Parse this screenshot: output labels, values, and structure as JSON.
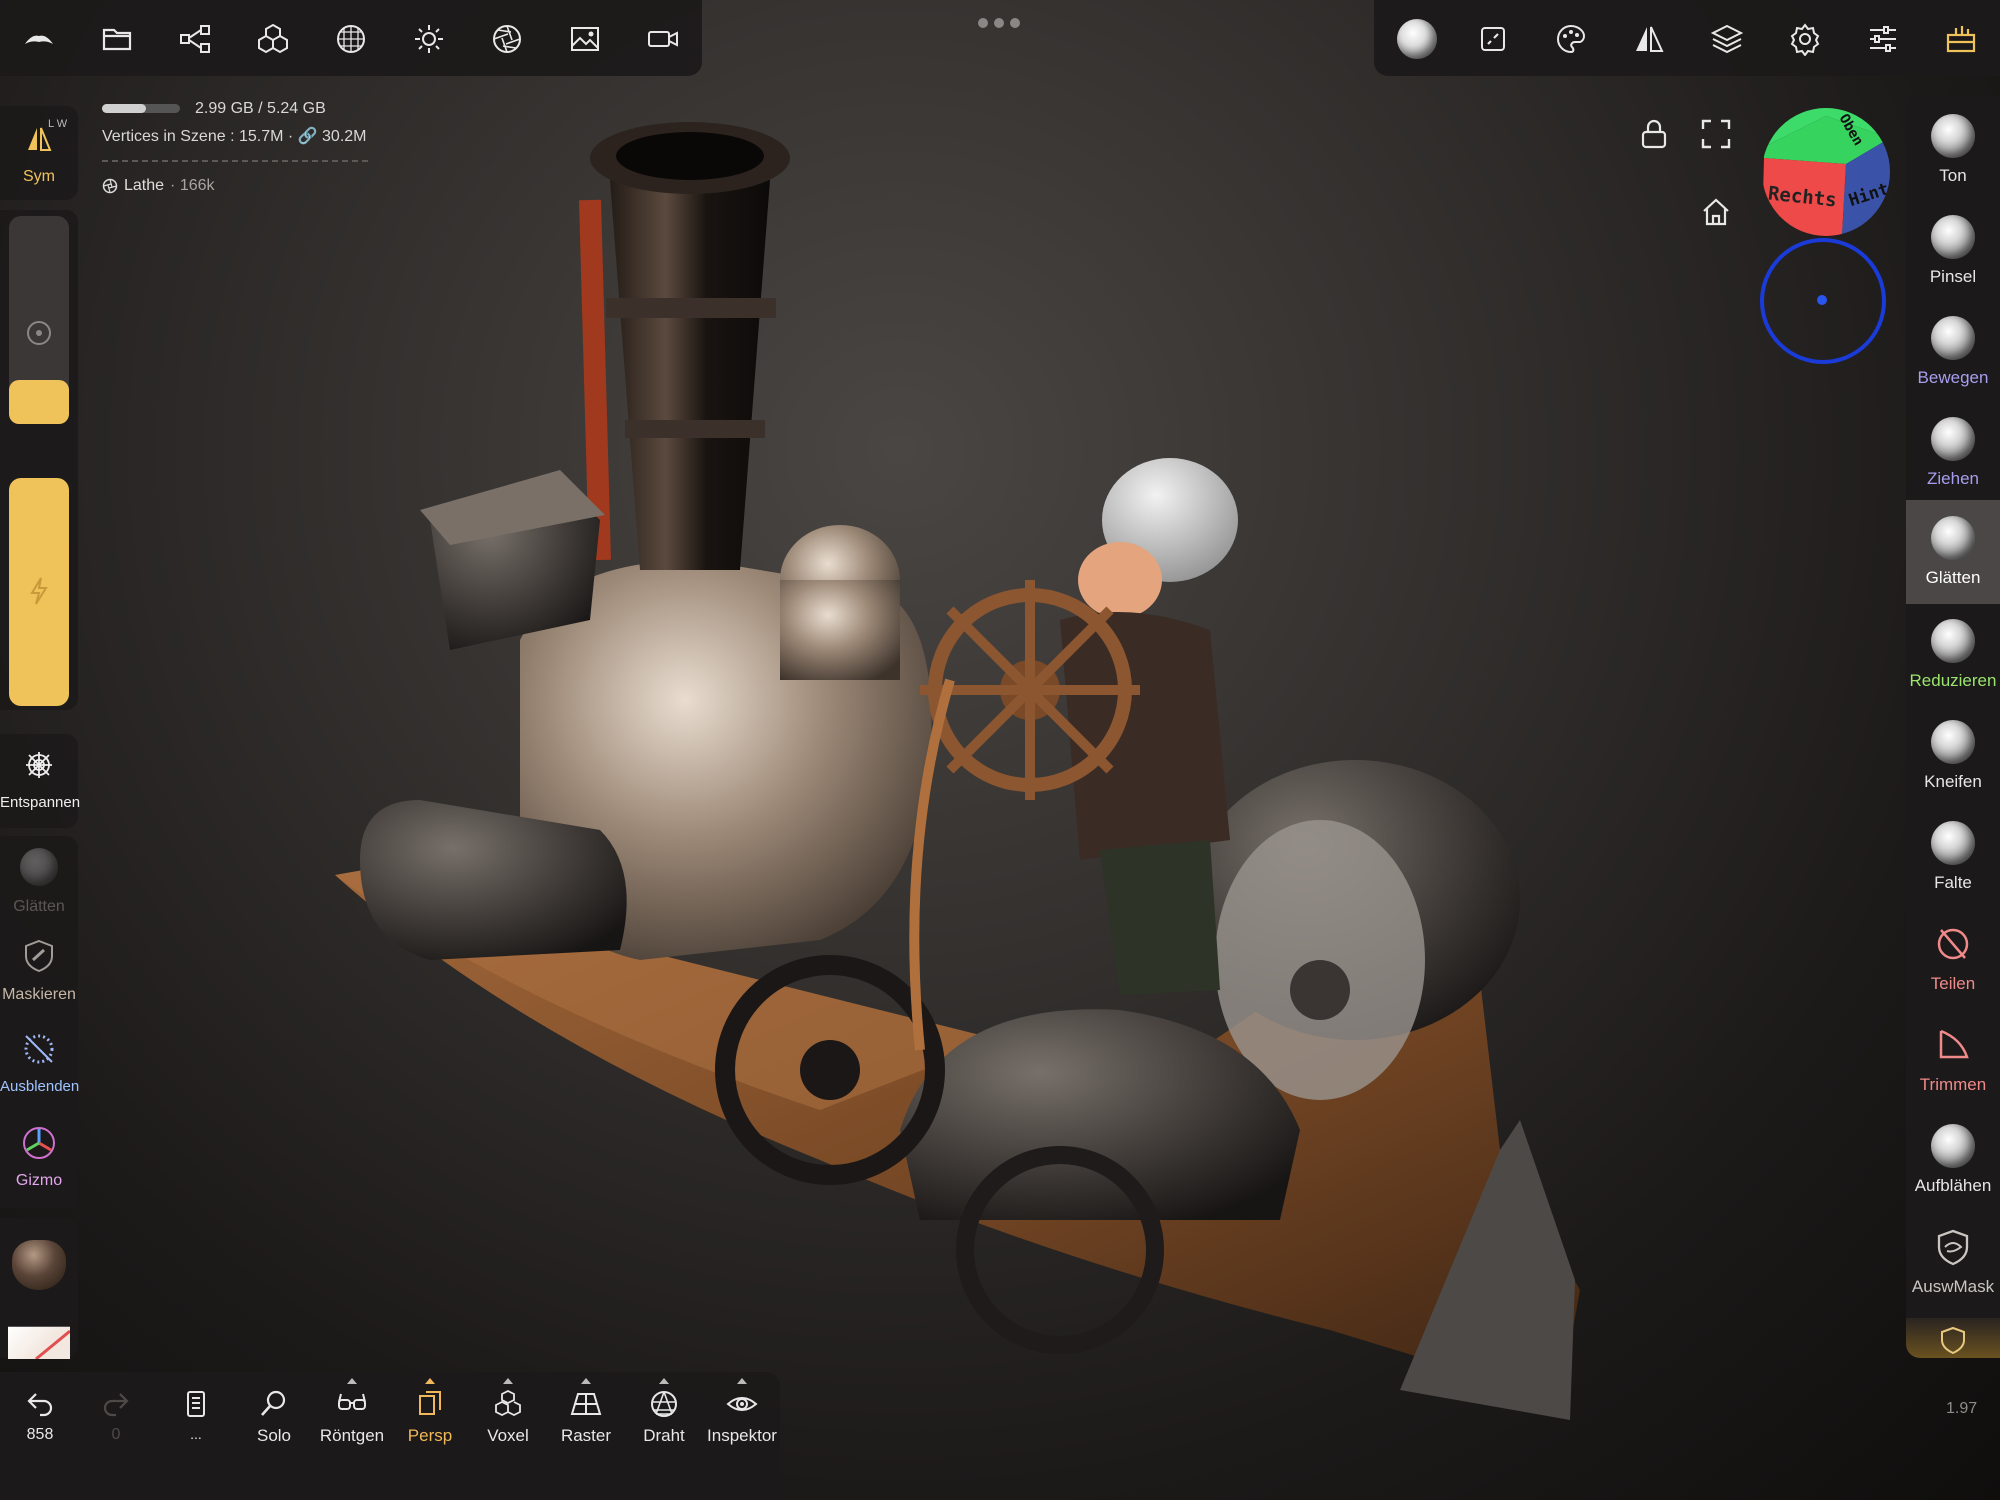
{
  "topbar": {
    "left_icons": [
      "nomad-logo-icon",
      "folder-icon",
      "share-nodes-icon",
      "cubes-icon",
      "mesh-sphere-icon",
      "sun-icon",
      "aperture-icon",
      "image-icon",
      "video-camera-icon"
    ],
    "right_icons": [
      "brush-sphere-icon",
      "stroke-icon",
      "palette-icon",
      "symmetry-icon",
      "layers-icon",
      "settings-gear-icon",
      "sliders-icon",
      "toolbox-icon"
    ]
  },
  "info": {
    "memory": "2.99 GB / 5.24 GB",
    "memory_fraction": 0.57,
    "vertices": "Vertices in Szene : 15.7M · 🔗 30.2M",
    "object_name": "Lathe",
    "object_count": "· 166k"
  },
  "left_toolbar": {
    "sym_label": "Sym",
    "sym_badge": "L W",
    "relax_label": "Entspannen",
    "smooth_label": "Glätten",
    "mask_label": "Maskieren",
    "hide_label": "Ausblenden",
    "gizmo_label": "Gizmo",
    "radius_value": 0.21,
    "intensity_value": 1.0
  },
  "viewport": {
    "lock_icon": "lock-icon",
    "fullscreen_icon": "fullscreen-icon",
    "home_icon": "home-icon",
    "viewcube": {
      "front": "Rechts",
      "side": "Hinten",
      "top": "Oben"
    }
  },
  "right_toolbar": {
    "items": [
      {
        "label": "Ton",
        "color": "#e6e6e6"
      },
      {
        "label": "Pinsel",
        "color": "#e6e6e6"
      },
      {
        "label": "Bewegen",
        "color": "#a79ef0"
      },
      {
        "label": "Ziehen",
        "color": "#a79ef0"
      },
      {
        "label": "Glätten",
        "color": "#ffffff",
        "active": true
      },
      {
        "label": "Reduzieren",
        "color": "#9be56e"
      },
      {
        "label": "Kneifen",
        "color": "#e6e6e6"
      },
      {
        "label": "Falte",
        "color": "#e6e6e6"
      },
      {
        "label": "Teilen",
        "color": "#f08a8a"
      },
      {
        "label": "Trimmen",
        "color": "#f08a8a"
      },
      {
        "label": "Aufblähen",
        "color": "#e6e6e6"
      },
      {
        "label": "AuswMask",
        "color": "#c9c6c2"
      }
    ]
  },
  "bottom_toolbar": {
    "undo_count": "858",
    "redo_count": "0",
    "items": [
      {
        "label": "...",
        "icon": "document-icon"
      },
      {
        "label": "Solo",
        "icon": "search-icon"
      },
      {
        "label": "Röntgen",
        "icon": "xray-glasses-icon"
      },
      {
        "label": "Persp",
        "icon": "perspective-icon",
        "active": true
      },
      {
        "label": "Voxel",
        "icon": "voxel-icon"
      },
      {
        "label": "Raster",
        "icon": "grid-icon"
      },
      {
        "label": "Draht",
        "icon": "wireframe-icon"
      },
      {
        "label": "Inspektor",
        "icon": "inspector-eye-icon"
      }
    ]
  },
  "zoom_value": "1.97",
  "colors": {
    "accent": "#f0c35a",
    "panel": "#1c1a19",
    "active_persp": "#f0b85a"
  }
}
